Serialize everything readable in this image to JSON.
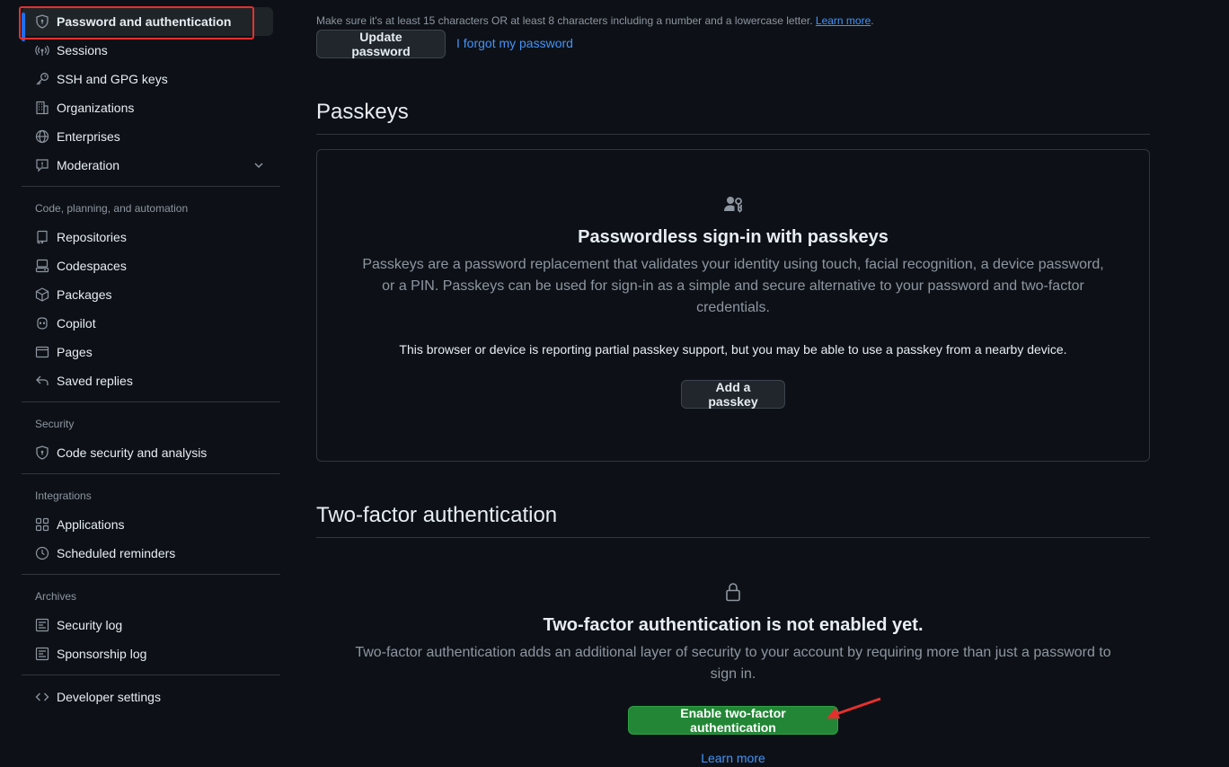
{
  "sidebar": {
    "items_top": [
      {
        "label": "Password and authentication",
        "icon": "shield-lock-icon",
        "active": true
      },
      {
        "label": "Sessions",
        "icon": "broadcast-icon"
      },
      {
        "label": "SSH and GPG keys",
        "icon": "key-icon"
      },
      {
        "label": "Organizations",
        "icon": "organization-icon"
      },
      {
        "label": "Enterprises",
        "icon": "globe-icon"
      },
      {
        "label": "Moderation",
        "icon": "report-icon"
      }
    ],
    "section_code": {
      "heading": "Code, planning, and automation",
      "items": [
        {
          "label": "Repositories",
          "icon": "repo-icon"
        },
        {
          "label": "Codespaces",
          "icon": "codespaces-icon"
        },
        {
          "label": "Packages",
          "icon": "package-icon"
        },
        {
          "label": "Copilot",
          "icon": "copilot-icon"
        },
        {
          "label": "Pages",
          "icon": "browser-icon"
        },
        {
          "label": "Saved replies",
          "icon": "reply-icon"
        }
      ]
    },
    "section_security": {
      "heading": "Security",
      "items": [
        {
          "label": "Code security and analysis",
          "icon": "shield-lock-icon"
        }
      ]
    },
    "section_integrations": {
      "heading": "Integrations",
      "items": [
        {
          "label": "Applications",
          "icon": "apps-icon"
        },
        {
          "label": "Scheduled reminders",
          "icon": "clock-icon"
        }
      ]
    },
    "section_archives": {
      "heading": "Archives",
      "items": [
        {
          "label": "Security log",
          "icon": "log-icon"
        },
        {
          "label": "Sponsorship log",
          "icon": "log-icon"
        }
      ]
    },
    "developer": {
      "label": "Developer settings",
      "icon": "code-icon"
    }
  },
  "password": {
    "hint": "Make sure it's at least 15 characters OR at least 8 characters including a number and a lowercase letter.",
    "hint_link": "Learn more",
    "update_button": "Update password",
    "forgot_link": "I forgot my password"
  },
  "passkeys": {
    "title": "Passkeys",
    "icon": "passkey-icon",
    "heading": "Passwordless sign-in with passkeys",
    "description": "Passkeys are a password replacement that validates your identity using touch, facial recognition, a device password, or a PIN. Passkeys can be used for sign-in as a simple and secure alternative to your password and two-factor credentials.",
    "note": "This browser or device is reporting partial passkey support, but you may be able to use a passkey from a nearby device.",
    "add_button": "Add a passkey"
  },
  "two_factor": {
    "title": "Two-factor authentication",
    "icon": "lock-icon",
    "heading": "Two-factor authentication is not enabled yet.",
    "description": "Two-factor authentication adds an additional layer of security to your account by requiring more than just a password to sign in.",
    "enable_button": "Enable two-factor authentication",
    "learn_more": "Learn more"
  },
  "colors": {
    "background": "#0d1117",
    "accent_link": "#4493f8",
    "primary_button": "#238636",
    "annotation": "#e5302d"
  }
}
